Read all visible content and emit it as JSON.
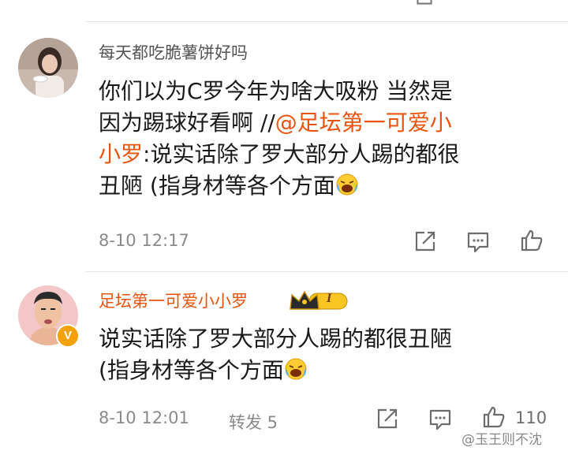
{
  "comments": [
    {
      "username": "每天都吃脆薯饼好吗",
      "text_lines": [
        "你们以为C罗今年为啥大吸粉 当然是",
        "因为踢球好看啊 //"
      ],
      "mention": "@足坛第一可爱小",
      "mention_cont": "小罗",
      "text_after_mention": ":说实话除了罗大部分人踢的都很",
      "text_last": "丑陋 (指身材等各个方面",
      "emoji": "laugh-cry-emoji",
      "timestamp": "8-10 12:17"
    },
    {
      "username": "足坛第一可爱小小罗",
      "badge_level": "I",
      "verified_label": "V",
      "text_line1": "说实话除了罗大部分人踢的都很丑陋",
      "text_line2": "(指身材等各个方面",
      "emoji": "laugh-cry-emoji",
      "timestamp": "8-10 12:01",
      "repost_label": "转发 5",
      "like_count": "110"
    }
  ],
  "watermark": "@玉王则不沈",
  "colors": {
    "accent": "#e8540e",
    "meta": "#8a8a8a",
    "badge_gold": "#f5a10a"
  }
}
